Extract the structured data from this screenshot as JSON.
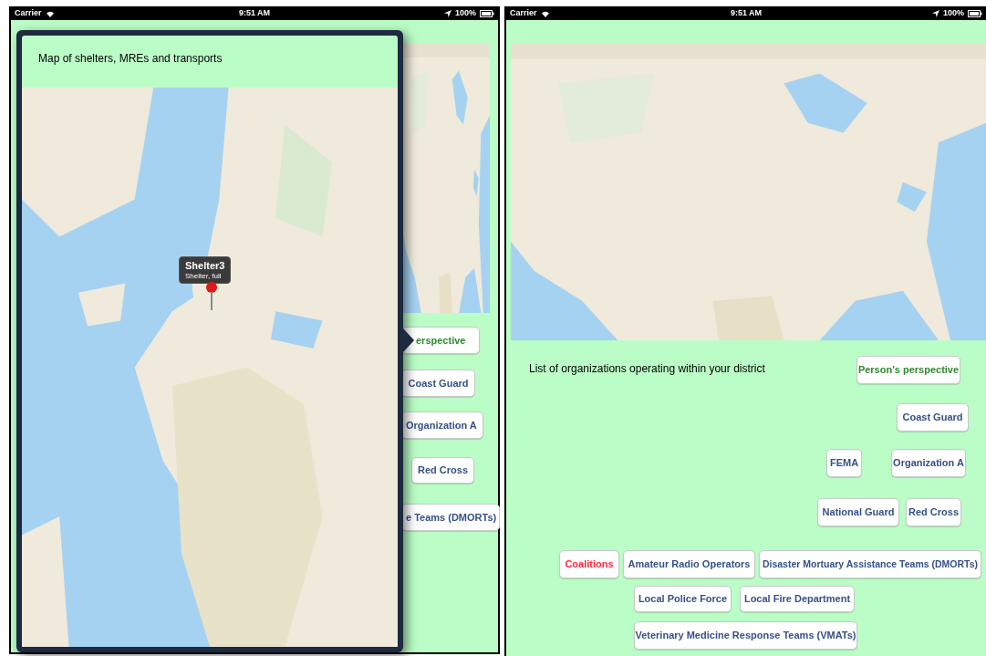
{
  "screens": [
    {
      "status_bar": {
        "carrier": "Carrier",
        "time": "9:51 AM",
        "battery": "100%"
      },
      "buttons": [
        {
          "label": "erspective",
          "color": "#2f8a2f"
        },
        {
          "label": "Coast Guard",
          "color": "#35508a"
        },
        {
          "label": "Organization A",
          "color": "#35508a"
        },
        {
          "label": "Red Cross",
          "color": "#35508a"
        },
        {
          "label": "e Teams (DMORTs)",
          "color": "#35508a"
        }
      ],
      "popover": {
        "title": "Map of shelters, MREs and transports",
        "callout": {
          "title": "Shelter3",
          "subtitle": "Shelter, full"
        }
      }
    },
    {
      "status_bar": {
        "carrier": "Carrier",
        "time": "9:51 AM",
        "battery": "100%"
      },
      "heading": "List of organizations operating within your district",
      "buttons": [
        {
          "label": "Person's perspective",
          "color": "#2f8a2f"
        },
        {
          "label": "Coast Guard",
          "color": "#35508a"
        },
        {
          "label": "FEMA",
          "color": "#35508a"
        },
        {
          "label": "Organization A",
          "color": "#35508a"
        },
        {
          "label": "National Guard",
          "color": "#35508a"
        },
        {
          "label": "Red Cross",
          "color": "#35508a"
        },
        {
          "label": "Coalitions",
          "color": "#ff2a3c"
        },
        {
          "label": "Amateur Radio Operators",
          "color": "#35508a"
        },
        {
          "label": "Disaster Mortuary Assistance Teams (DMORTs)",
          "color": "#35508a"
        },
        {
          "label": "Local Police Force",
          "color": "#35508a"
        },
        {
          "label": "Local Fire Department",
          "color": "#35508a"
        },
        {
          "label": "Veterinary Medicine Response Teams (VMATs)",
          "color": "#35508a"
        }
      ]
    }
  ]
}
